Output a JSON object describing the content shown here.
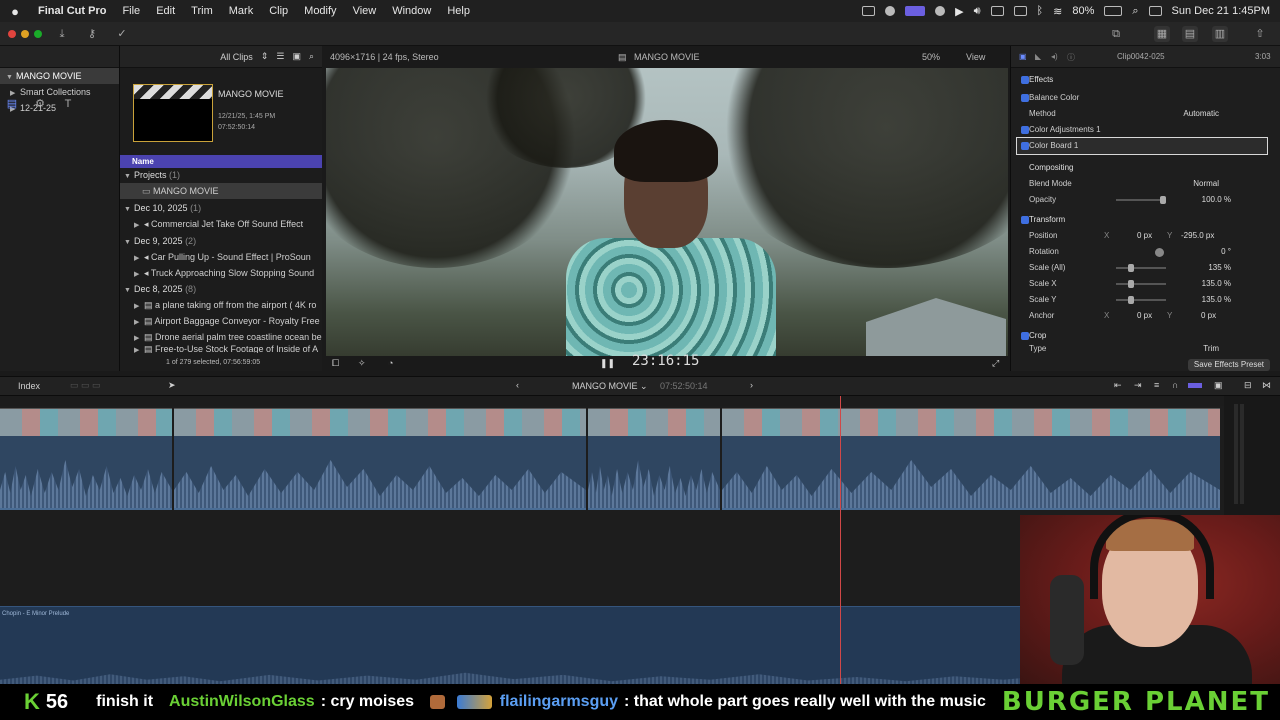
{
  "menubar": {
    "app_name": "Final Cut Pro",
    "items": [
      "File",
      "Edit",
      "Trim",
      "Mark",
      "Clip",
      "Modify",
      "View",
      "Window",
      "Help"
    ],
    "battery": "80%",
    "datetime": "Sun Dec 21  1:45PM"
  },
  "libraries": {
    "root": "MANGO MOVIE",
    "items": [
      "Smart Collections",
      "12-21-25"
    ]
  },
  "browser": {
    "filter": "All Clips",
    "project_title": "MANGO MOVIE",
    "project_date": "12/21/25, 1:45 PM",
    "project_duration": "07:52:50:14",
    "column_name": "Name",
    "groups": [
      {
        "label": "Projects",
        "count": "(1)"
      },
      {
        "label": "Dec 10, 2025",
        "count": "(1)"
      },
      {
        "label": "Dec 9, 2025",
        "count": "(2)"
      },
      {
        "label": "Dec 8, 2025",
        "count": "(8)"
      }
    ],
    "rows": [
      "MANGO MOVIE",
      "Commercial Jet Take Off Sound Effect",
      "Car Pulling Up - Sound Effect  |  ProSoun",
      "Truck Approaching Slow Stopping Sound",
      "a plane taking off from the airport ( 4K ro",
      "Airport Baggage Conveyor - Royalty Free",
      "Drone aerial palm tree coastline ocean be",
      "Free-to-Use Stock Footage of Inside of A"
    ],
    "selection_status": "1 of 279 selected, 07:56:59:05"
  },
  "viewer": {
    "format": "4096×1716 | 24 fps, Stereo",
    "title": "MANGO MOVIE",
    "zoom": "50%",
    "view_menu": "View",
    "timecode": "23:16:15"
  },
  "inspector": {
    "clip_name": "Clip0042-025",
    "duration": "3:03",
    "effects_label": "Effects",
    "balance_color": "Balance Color",
    "method_label": "Method",
    "method_value": "Automatic",
    "color_adjustments": "Color Adjustments 1",
    "color_board": "Color Board 1",
    "compositing": "Compositing",
    "blend_mode_label": "Blend Mode",
    "blend_mode_value": "Normal",
    "opacity_label": "Opacity",
    "opacity_value": "100.0 %",
    "transform": "Transform",
    "position_label": "Position",
    "position_x": "0 px",
    "position_y": "-295.0 px",
    "rotation_label": "Rotation",
    "rotation_value": "0 °",
    "scale_all_label": "Scale (All)",
    "scale_all_value": "135 %",
    "scale_x_label": "Scale X",
    "scale_x_value": "135.0 %",
    "scale_y_label": "Scale Y",
    "scale_y_value": "135.0 %",
    "anchor_label": "Anchor",
    "anchor_x": "0 px",
    "anchor_y": "0 px",
    "crop": "Crop",
    "type_label": "Type",
    "type_value": "Trim",
    "save_preset": "Save Effects Preset"
  },
  "timeline": {
    "index_label": "Index",
    "project_name": "MANGO MOVIE",
    "project_duration": "07:52:50:14",
    "music_clip": "Chopin - E Minor Prelude"
  },
  "chat": {
    "k_label": "K",
    "count": "56",
    "line1": "finish it",
    "user1": "AustinWilsonGlass",
    "msg1": ": cry moises",
    "user2": "flailingarmsguy",
    "msg2": ": that whole part goes really well with the music",
    "brand": "BURGER PLANET"
  },
  "colors": {
    "accent": "#4b43b0",
    "checkbox": "#3f6fe0",
    "playhead": "#d04848",
    "chat_green": "#6ad035",
    "chat_blue": "#5b9ef2"
  }
}
